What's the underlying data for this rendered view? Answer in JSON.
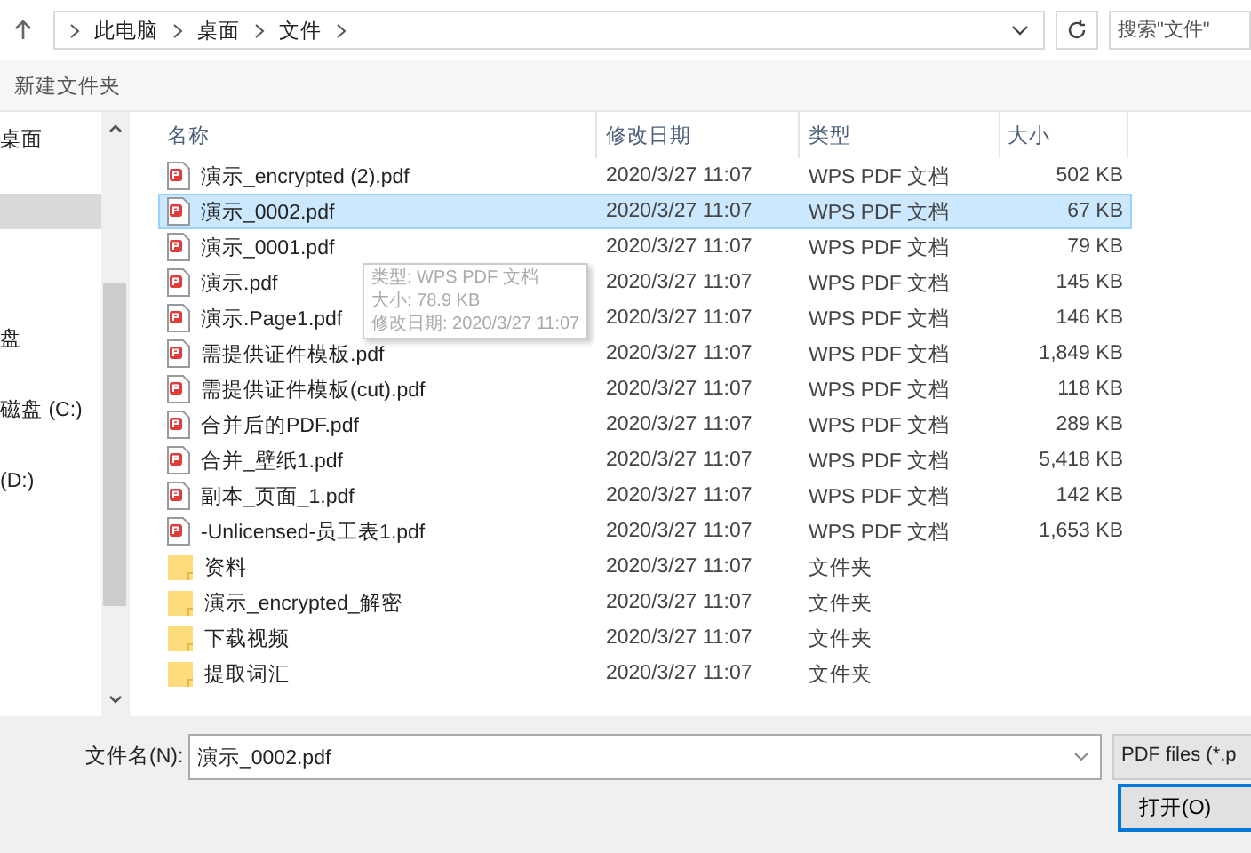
{
  "address_bar": {
    "path": [
      "此电脑",
      "桌面",
      "文件"
    ]
  },
  "search": {
    "placeholder": "搜索\"文件\""
  },
  "toolbar": {
    "new_folder": "新建文件夹"
  },
  "sidebar": {
    "items": [
      {
        "label": "桌面",
        "selected": false
      },
      {
        "selected": true
      },
      {
        "label": "盘",
        "selected": false
      },
      {
        "label": "磁盘 (C:)",
        "selected": false
      },
      {
        "label": "(D:)",
        "selected": false
      }
    ]
  },
  "table": {
    "columns": [
      "名称",
      "修改日期",
      "类型",
      "大小"
    ],
    "rows": [
      {
        "kind": "pdf",
        "name": "演示_encrypted (2).pdf",
        "date": "2020/3/27 11:07",
        "type": "WPS PDF 文档",
        "size": "502 KB",
        "selected": false
      },
      {
        "kind": "pdf",
        "name": "演示_0002.pdf",
        "date": "2020/3/27 11:07",
        "type": "WPS PDF 文档",
        "size": "67 KB",
        "selected": true
      },
      {
        "kind": "pdf",
        "name": "演示_0001.pdf",
        "date": "2020/3/27 11:07",
        "type": "WPS PDF 文档",
        "size": "79 KB",
        "selected": false
      },
      {
        "kind": "pdf",
        "name": "演示.pdf",
        "date": "2020/3/27 11:07",
        "type": "WPS PDF 文档",
        "size": "145 KB",
        "selected": false
      },
      {
        "kind": "pdf",
        "name": "演示.Page1.pdf",
        "date": "2020/3/27 11:07",
        "type": "WPS PDF 文档",
        "size": "146 KB",
        "selected": false
      },
      {
        "kind": "pdf",
        "name": "需提供证件模板.pdf",
        "date": "2020/3/27 11:07",
        "type": "WPS PDF 文档",
        "size": "1,849 KB",
        "selected": false
      },
      {
        "kind": "pdf",
        "name": "需提供证件模板(cut).pdf",
        "date": "2020/3/27 11:07",
        "type": "WPS PDF 文档",
        "size": "118 KB",
        "selected": false
      },
      {
        "kind": "pdf",
        "name": "合并后的PDF.pdf",
        "date": "2020/3/27 11:07",
        "type": "WPS PDF 文档",
        "size": "289 KB",
        "selected": false
      },
      {
        "kind": "pdf",
        "name": "合并_壁纸1.pdf",
        "date": "2020/3/27 11:07",
        "type": "WPS PDF 文档",
        "size": "5,418 KB",
        "selected": false
      },
      {
        "kind": "pdf",
        "name": "副本_页面_1.pdf",
        "date": "2020/3/27 11:07",
        "type": "WPS PDF 文档",
        "size": "142 KB",
        "selected": false
      },
      {
        "kind": "pdf",
        "name": "-Unlicensed-员工表1.pdf",
        "date": "2020/3/27 11:07",
        "type": "WPS PDF 文档",
        "size": "1,653 KB",
        "selected": false
      },
      {
        "kind": "folder",
        "name": "资料",
        "date": "2020/3/27 11:07",
        "type": "文件夹",
        "selected": false
      },
      {
        "kind": "folder",
        "name": "演示_encrypted_解密",
        "date": "2020/3/27 11:07",
        "type": "文件夹",
        "selected": false
      },
      {
        "kind": "folder",
        "name": "下载视频",
        "date": "2020/3/27 11:07",
        "type": "文件夹",
        "selected": false
      },
      {
        "kind": "folder",
        "name": "提取词汇",
        "date": "2020/3/27 11:07",
        "type": "文件夹",
        "selected": false
      }
    ]
  },
  "tooltip": [
    "类型: WPS PDF 文档",
    "大小: 78.9 KB",
    "修改日期: 2020/3/27 11:07"
  ],
  "footer": {
    "filename_label": "文件名(N):",
    "filename": "演示_0002.pdf",
    "filter": "PDF files (*.p",
    "open_button": "打开(O)"
  }
}
